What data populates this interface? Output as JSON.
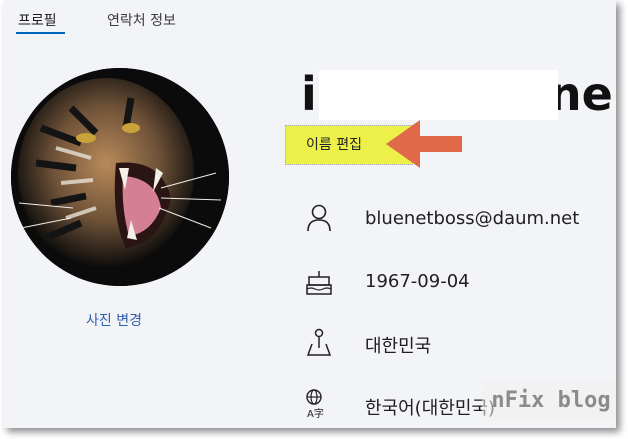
{
  "tabs": [
    {
      "label": "프로필"
    },
    {
      "label": "연락처 정보"
    }
  ],
  "profile": {
    "change_photo_label": "사진 변경",
    "name_visible_start": "i",
    "name_visible_end": "gyne",
    "edit_name_label": "이름 편집"
  },
  "info": {
    "email": "bluenetboss@daum.net",
    "birthday": "1967-09-04",
    "country": "대한민국",
    "language": "한국어(대한민국)"
  },
  "watermark": "nFix blog",
  "colors": {
    "accent": "#0067c0",
    "link": "#2f5fae",
    "highlight": "#eef04a",
    "arrow": "#e0694a"
  }
}
